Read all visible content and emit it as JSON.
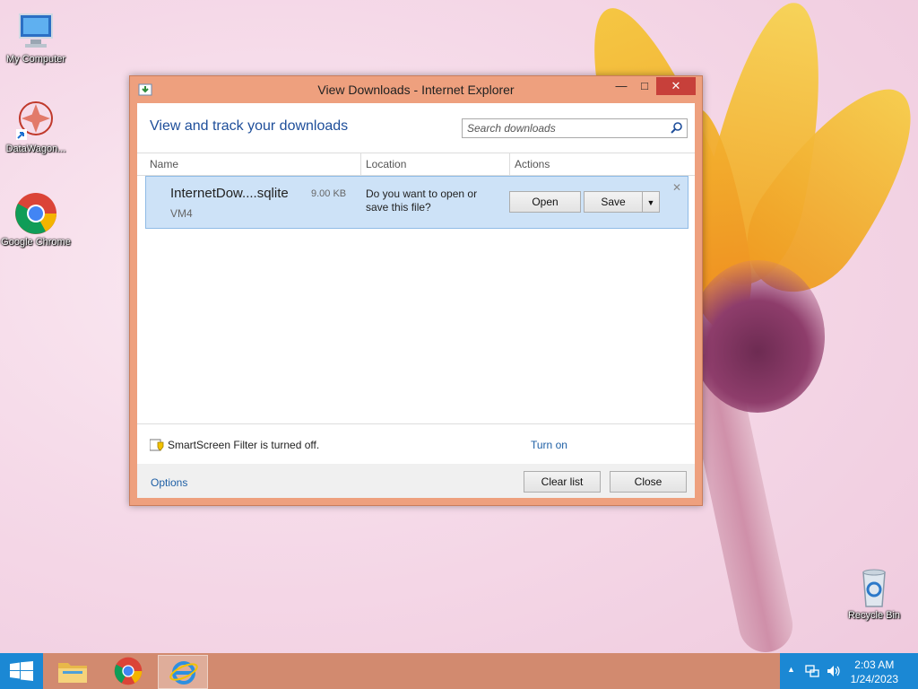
{
  "desktop": {
    "icons": [
      {
        "label": "My Computer"
      },
      {
        "label": "DataWagon..."
      },
      {
        "label": "Google Chrome"
      },
      {
        "label": "Recycle Bin"
      }
    ]
  },
  "window": {
    "title": "View Downloads - Internet Explorer",
    "heading": "View and track your downloads",
    "search_placeholder": "Search downloads",
    "columns": {
      "name": "Name",
      "location": "Location",
      "actions": "Actions"
    },
    "download": {
      "filename": "InternetDow....sqlite",
      "size": "9.00 KB",
      "source": "VM4",
      "prompt": "Do you want to open or save this file?",
      "open_label": "Open",
      "save_label": "Save"
    },
    "smartscreen": {
      "text": "SmartScreen Filter is turned off.",
      "action": "Turn on"
    },
    "footer": {
      "options": "Options",
      "clear_list": "Clear list",
      "close": "Close"
    }
  },
  "taskbar": {
    "clock_time": "2:03 AM",
    "clock_date": "1/24/2023"
  },
  "colors": {
    "accent": "#1b88d4",
    "window_frame": "#eea07e",
    "close_button": "#c7403a",
    "link": "#1e5fa5"
  }
}
